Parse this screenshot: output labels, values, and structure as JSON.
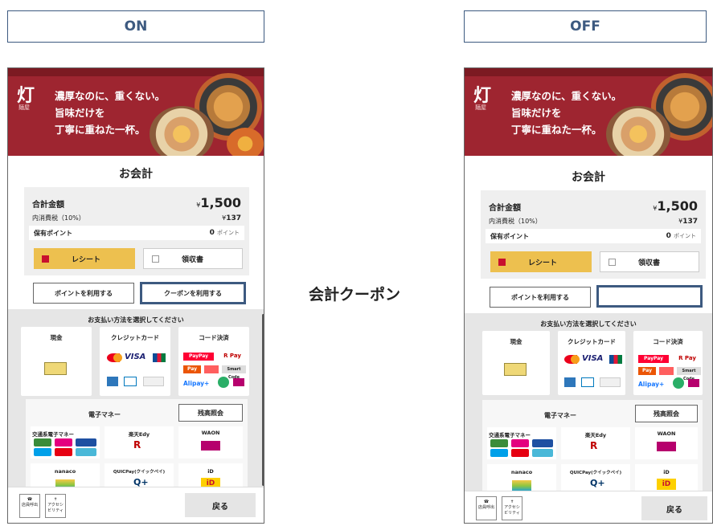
{
  "labels": {
    "left": "ON",
    "right": "OFF",
    "center": "会計クーポン"
  },
  "banner": {
    "logo": "灯",
    "logo_sub": "麺屋",
    "tagline": [
      "濃厚なのに、重くない。",
      "旨味だけを",
      "丁寧に重ねた一杯。"
    ]
  },
  "checkout": {
    "title": "お会計",
    "total_label": "合計金額",
    "total_yen": "¥",
    "total_value": "1,500",
    "tax_label": "内消費税（10%）",
    "tax_yen": "¥",
    "tax_value": "137",
    "points_label": "保有ポイント",
    "points_value": "0",
    "points_unit": "ポイント",
    "receipt_label": "レシート",
    "invoice_label": "領収書",
    "use_points_label": "ポイントを利用する",
    "use_coupon_label": "クーポンを利用する"
  },
  "payment": {
    "title": "お支払い方法を選択してください",
    "cash": "現金",
    "credit": "クレジットカード",
    "code": "コード決済",
    "visa": "VISA",
    "jcb": "JCB",
    "paypay": "PayPay",
    "rpay": "R Pay",
    "aupay": "Pay",
    "smart": "Smart Code",
    "alipay": "Alipay+",
    "emoney_title": "電子マネー",
    "balance_btn": "残高照会",
    "transit": "交通系電子マネー",
    "edy": "楽天Edy",
    "waon": "WAON",
    "nanaco": "nanaco",
    "quicpay": "QUICPay(クイックペイ)",
    "id": "iD"
  },
  "footer": {
    "call_staff": "店員呼出",
    "accessibility": "アクセシビリティ",
    "back": "戻る"
  },
  "colors": {
    "accent": "#3d5a80",
    "banner": "#9e2530",
    "receipt": "#edc04f",
    "check": "#c8102e"
  }
}
